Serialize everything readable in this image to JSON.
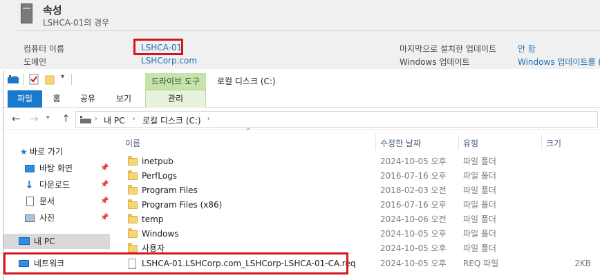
{
  "properties": {
    "title": "속성",
    "subtitle": "LSHCA-01의 경우",
    "computer_name_label": "컴퓨터 이름",
    "computer_name_value": "LSHCA-01",
    "domain_label": "도메인",
    "domain_value": "LSHCorp.com",
    "last_update_label": "마지막으로 설치한 업데이트",
    "last_update_value": "안 함",
    "windows_update_label": "Windows 업데이트",
    "windows_update_value": "Windows 업데이트를 (",
    "highlight_color": "#d4161c"
  },
  "explorer": {
    "window_title": "로컬 디스크 (C:)",
    "contextual_group": "드라이브 도구",
    "tabs": {
      "file": "파일",
      "home": "홈",
      "share": "공유",
      "view": "보기",
      "manage": "관리"
    },
    "address": {
      "this_pc": "내 PC",
      "drive": "로컬 디스크 (C:)",
      "separator": "›"
    },
    "nav": {
      "quick_access": "바로 가기",
      "desktop": "바탕 화면",
      "downloads": "다운로드",
      "documents": "문서",
      "pictures": "사진",
      "this_pc": "내 PC",
      "network": "네트워크"
    },
    "columns": {
      "name": "이름",
      "date": "수정한 날짜",
      "type": "유형",
      "size": "크기"
    },
    "files": [
      {
        "name": "inetpub",
        "date": "2024-10-05 오후 ...",
        "type": "파일 폴더",
        "size": "",
        "icon": "folder-icon"
      },
      {
        "name": "PerfLogs",
        "date": "2016-07-16 오후 ...",
        "type": "파일 폴더",
        "size": "",
        "icon": "folder-icon"
      },
      {
        "name": "Program Files",
        "date": "2018-02-03 오전 ...",
        "type": "파일 폴더",
        "size": "",
        "icon": "folder-icon"
      },
      {
        "name": "Program Files (x86)",
        "date": "2016-07-16 오후 ...",
        "type": "파일 폴더",
        "size": "",
        "icon": "folder-icon"
      },
      {
        "name": "temp",
        "date": "2024-10-06 오전 ...",
        "type": "파일 폴더",
        "size": "",
        "icon": "folder-icon"
      },
      {
        "name": "Windows",
        "date": "2024-10-05 오후 ...",
        "type": "파일 폴더",
        "size": "",
        "icon": "folder-icon"
      },
      {
        "name": "사용자",
        "date": "2024-10-05 오후 ...",
        "type": "파일 폴더",
        "size": "",
        "icon": "folder-icon"
      },
      {
        "name": "LSHCA-01.LSHCorp.com_LSHCorp-LSHCA-01-CA.req",
        "date": "2024-10-05 오후 ...",
        "type": "REQ 파일",
        "size": "2KB",
        "icon": "file-icon"
      }
    ]
  }
}
